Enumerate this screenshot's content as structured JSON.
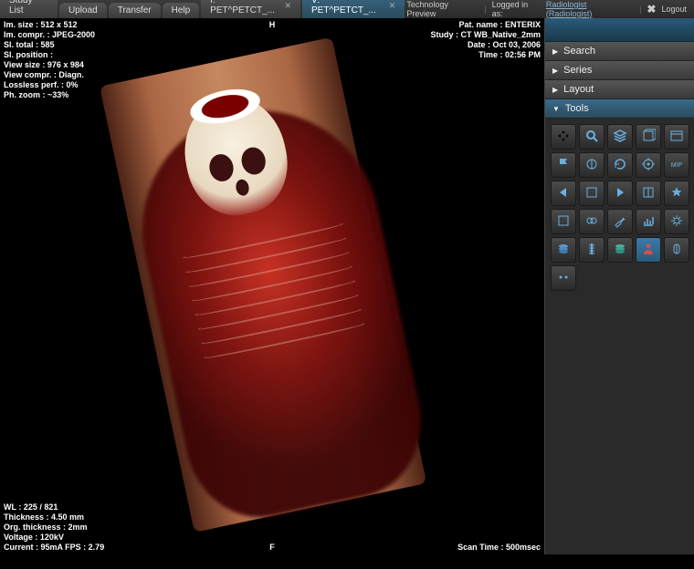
{
  "tabs": [
    {
      "label": "Study List",
      "close": false
    },
    {
      "label": "Upload",
      "close": false
    },
    {
      "label": "Transfer",
      "close": false
    },
    {
      "label": "Help",
      "close": false
    },
    {
      "label": "I: PET^PETCT_...",
      "close": true
    },
    {
      "label": "V: PET^PETCT_...",
      "close": true,
      "active": true
    }
  ],
  "topright": {
    "preview": "Technology Preview",
    "logged_label": "Logged in as:",
    "user_link": "Radiologist (Radiologist)",
    "logout": "Logout"
  },
  "overlay_tl": [
    "Im. size : 512 x 512",
    "Im. compr. : JPEG-2000",
    "Sl. total : 585",
    "Sl. position :",
    "View size : 976 x 984",
    "View compr. : Diagn.",
    "Lossless perf. : 0%",
    "Ph. zoom : ~33%"
  ],
  "overlay_tr": [
    "Pat. name : ENTERIX",
    "Study : CT WB_Native_2mm",
    "Date : Oct 03, 2006",
    "Time : 02:56 PM"
  ],
  "overlay_bl": [
    "WL : 225 / 821",
    "Thickness : 4.50 mm",
    "Org. thickness : 2mm",
    "Voltage : 120kV",
    "Current : 95mA     FPS : 2.79"
  ],
  "overlay_br": [
    "Scan Time : 500msec"
  ],
  "orient_top": "H",
  "orient_bottom": "F",
  "sidebar": {
    "items": [
      "Search",
      "Series",
      "Layout",
      "Tools"
    ],
    "open_index": 3
  },
  "tool_icons": [
    "nav-arrows",
    "zoom",
    "layers",
    "grid-3d",
    "window",
    "flag",
    "eye-split",
    "rotate",
    "target",
    "mip",
    "play-left",
    "film",
    "play-right",
    "book",
    "star",
    "blank",
    "circles",
    "wrench",
    "chart",
    "gear2",
    "stack-blue",
    "spine",
    "stack-teal",
    "person-red",
    "brain",
    "dots"
  ],
  "colors": {
    "accent": "#3a7aaa",
    "icon": "#6ab0e0"
  }
}
